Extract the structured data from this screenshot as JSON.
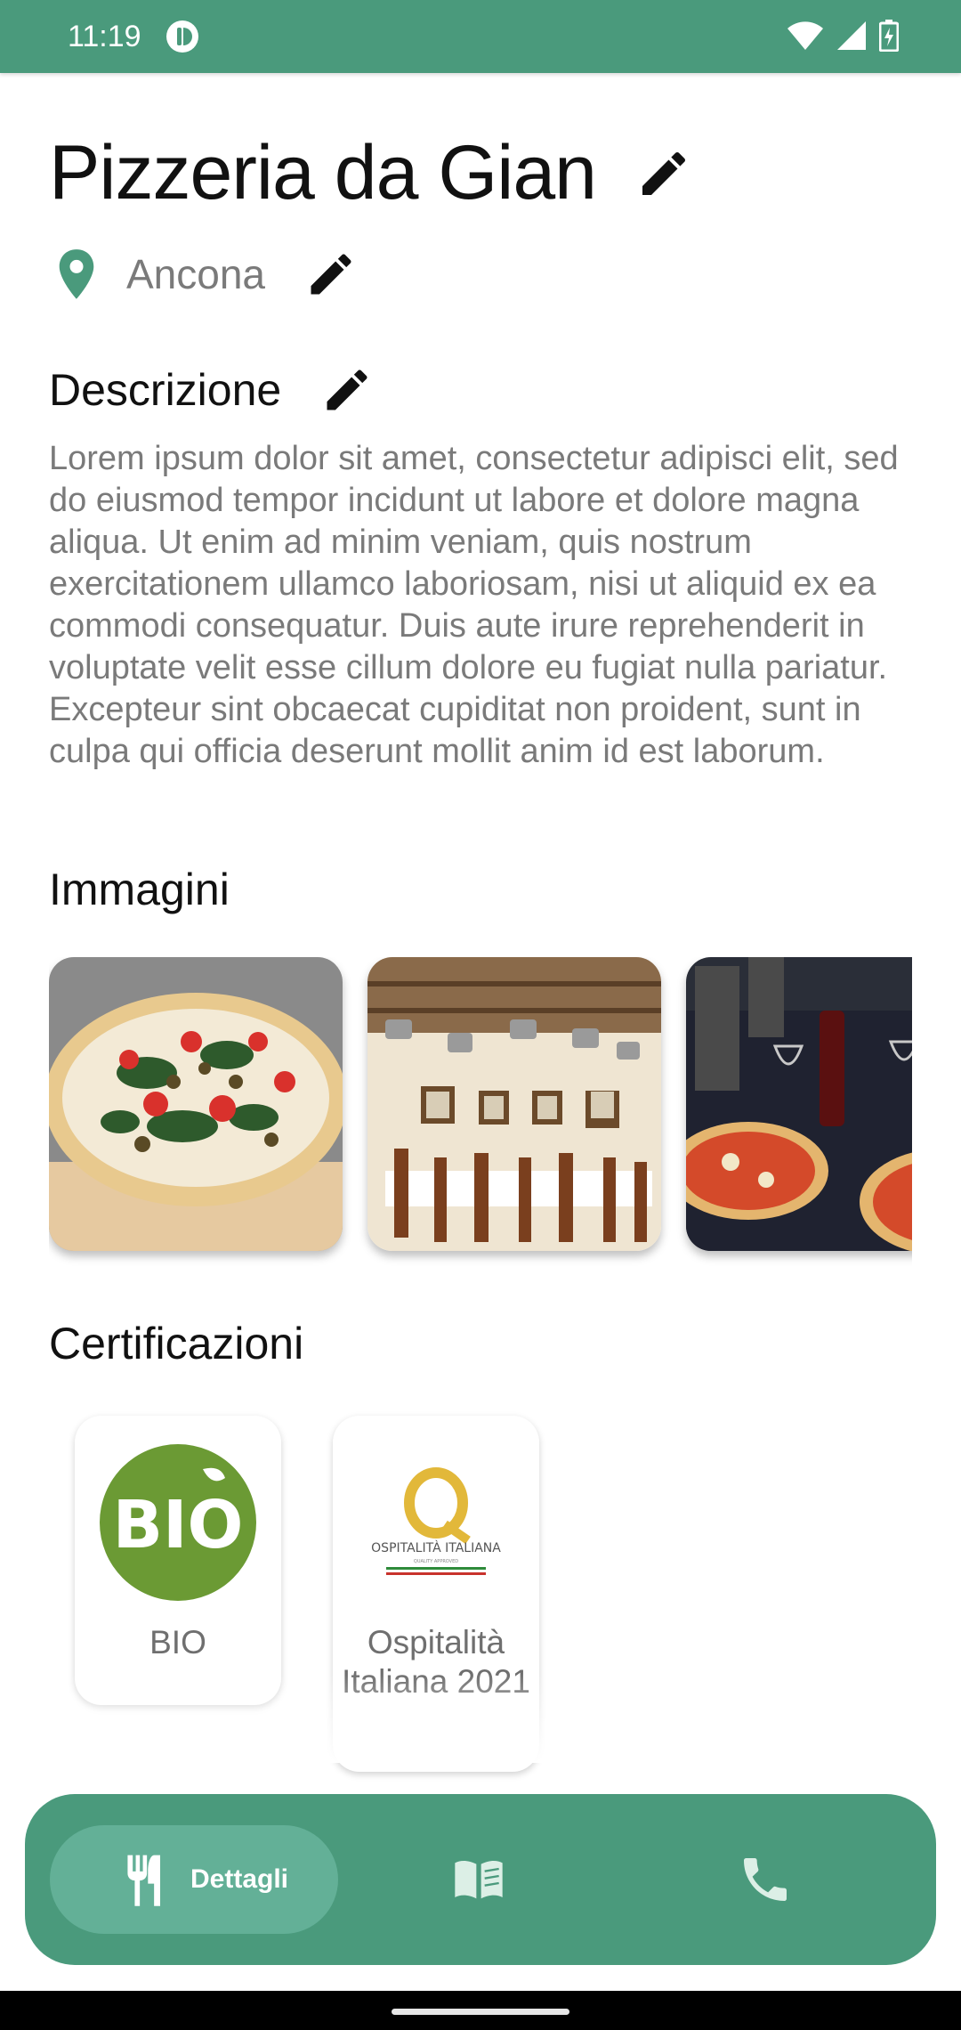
{
  "status_bar": {
    "time": "11:19",
    "color": "#4a9a7c"
  },
  "restaurant": {
    "name": "Pizzeria da Gian",
    "location": "Ancona"
  },
  "description": {
    "heading": "Descrizione",
    "text": "Lorem ipsum dolor sit amet, consectetur adipisci elit, sed do eiusmod tempor incidunt ut labore et dolore magna aliqua. Ut enim ad minim veniam, quis nostrum exercitationem ullamco laboriosam, nisi ut aliquid ex ea commodi consequatur. Duis aute irure reprehenderit in voluptate velit esse cillum dolore eu fugiat nulla pariatur. Excepteur sint obcaecat cupiditat non proident, sunt in culpa qui officia deserunt mollit anim id est laborum."
  },
  "images": {
    "heading": "Immagini",
    "items": [
      "pizza-photo",
      "dining-room-photo",
      "table-pizzas-photo"
    ]
  },
  "certifications": {
    "heading": "Certificazioni",
    "items": [
      {
        "label": "BIO",
        "logo_text": "BIO"
      },
      {
        "label": "Ospitalità Italiana 2021",
        "logo_text": "OSPITALITÀ ITALIANA",
        "logo_subtext": "QUALITY APPROVED"
      }
    ]
  },
  "bottom_nav": {
    "items": [
      {
        "label": "Dettagli",
        "icon": "restaurant-icon",
        "active": true
      },
      {
        "label": "",
        "icon": "menu-book-icon",
        "active": false
      },
      {
        "label": "",
        "icon": "phone-icon",
        "active": false
      }
    ]
  },
  "colors": {
    "accent": "#4a9a7c",
    "accent_light": "#63b097"
  }
}
